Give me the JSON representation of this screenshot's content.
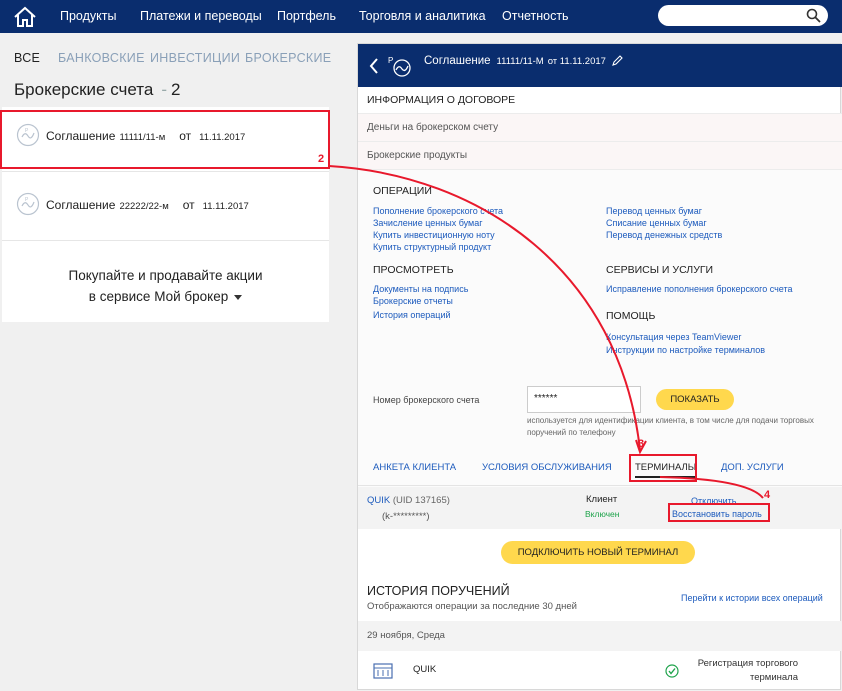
{
  "nav": {
    "items": [
      "Продукты",
      "Платежи и переводы",
      "Портфель",
      "Торговля и аналитика",
      "Отчетность"
    ],
    "search_placeholder": ""
  },
  "filters": [
    "ВСЕ",
    "БАНКОВСКИЕ",
    "ИНВЕСТИЦИИ",
    "БРОКЕРСКИЕ"
  ],
  "accounts_section": {
    "title": "Брокерские счета",
    "count": "2"
  },
  "accounts": [
    {
      "label": "Соглашение",
      "number": "11111/11-м",
      "from_label": "от",
      "date": "11.11.2017"
    },
    {
      "label": "Соглашение",
      "number": "22222/22-м",
      "from_label": "от",
      "date": "11.11.2017"
    }
  ],
  "promo": {
    "line1": "Покупайте и продавайте акции",
    "line2": "в сервисе Мой брокер"
  },
  "panel": {
    "title": "Соглашение",
    "number": "11111/11-М",
    "date_text": "от 11.11.2017",
    "info_header": "ИНФОРМАЦИЯ О ДОГОВОРЕ",
    "money_row": "Деньги на брокерском счету",
    "products_row": "Брокерские продукты"
  },
  "operations": {
    "ops_title": "ОПЕРАЦИИ",
    "ops_left": [
      "Пополнение брокерского счета",
      "Зачисление ценных бумаг",
      "Купить инвестиционную ноту",
      "Купить структурный продукт"
    ],
    "ops_right": [
      "Перевод ценных бумаг",
      "Списание ценных бумаг",
      "Перевод денежных средств"
    ],
    "view_title": "ПРОСМОТРЕТЬ",
    "view_links": [
      "Документы на подпись",
      "Брокерские отчеты",
      "История операций"
    ],
    "services_title": "СЕРВИСЫ И УСЛУГИ",
    "services_links": [
      "Исправление пополнения брокерского счета"
    ],
    "help_title": "ПОМОЩЬ",
    "help_links": [
      "Консультация через TeamViewer",
      "Инструкции по настройке терминалов"
    ]
  },
  "account_number": {
    "label": "Номер брокерского счета",
    "value": "******",
    "button": "ПОКАЗАТЬ",
    "hint": "используется для идентификации клиента, в том числе для подачи торговых поручений по телефону"
  },
  "tabs": [
    "АНКЕТА КЛИЕНТА",
    "УСЛОВИЯ ОБСЛУЖИВАНИЯ",
    "ТЕРМИНАЛЫ",
    "ДОП. УСЛУГИ"
  ],
  "terminal": {
    "name": "QUIK",
    "uid": "(UID 137165)",
    "login": "(k-*********)",
    "client_label": "Клиент",
    "status": "Включен",
    "disable_link": "Отключить",
    "restore_link": "Восстановить пароль"
  },
  "connect_button": "ПОДКЛЮЧИТЬ НОВЫЙ ТЕРМИНАЛ",
  "history": {
    "title": "ИСТОРИЯ ПОРУЧЕНИЙ",
    "subtitle": "Отображаются операции за последние 30 дней",
    "link": "Перейти к истории всех операций",
    "date": "29 ноября, Среда",
    "item_name": "QUIK",
    "item_desc": "Регистрация торгового терминала"
  },
  "annotations": [
    "2",
    "3",
    "4"
  ],
  "colors": {
    "nav_bg": "#0a2d6e",
    "link": "#1d5bbd",
    "button_yellow": "#ffd84d",
    "highlight_red": "#e8192c",
    "status_green": "#1ea34b"
  }
}
